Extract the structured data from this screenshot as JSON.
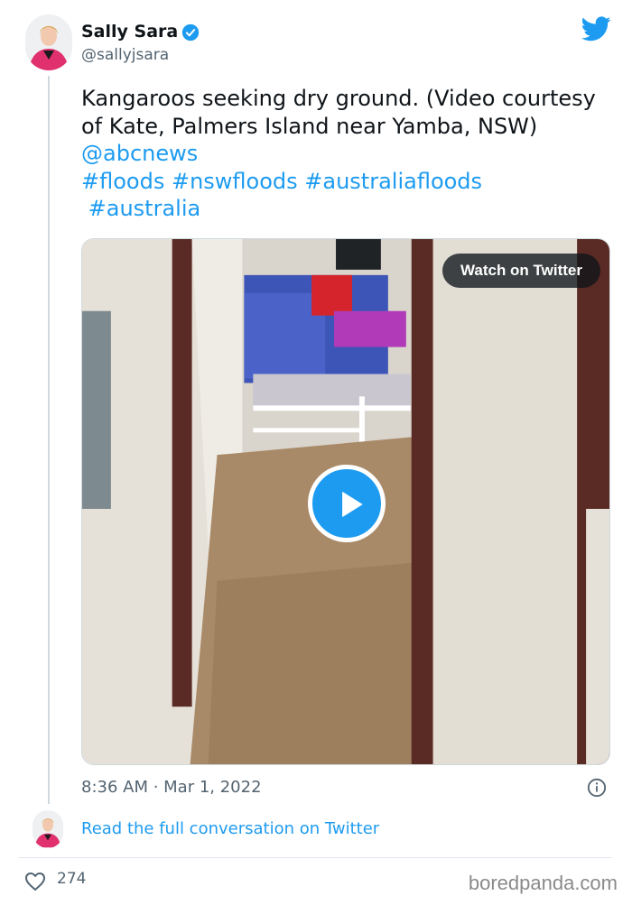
{
  "author": {
    "display_name": "Sally Sara",
    "handle": "@sallyjsara",
    "verified": true
  },
  "tweet": {
    "text_plain": "Kangaroos seeking dry ground.  (Video courtesy of Kate, Palmers Island near Yamba, NSW) ",
    "mention": "@abcnews",
    "hashtags_line1": "#floods #nswfloods #australiafloods",
    "hashtag_line2": "#australia"
  },
  "media": {
    "watch_label": "Watch on Twitter",
    "play_icon": "play-icon"
  },
  "timestamp": "8:36 AM · Mar 1, 2022",
  "read_full_conversation": "Read the full conversation on Twitter",
  "likes": "274",
  "watermark": "boredpanda.com",
  "colors": {
    "accent": "#1d9bf0",
    "text": "#0f1419",
    "muted": "#536471"
  },
  "icons": [
    "verified-badge-icon",
    "twitter-bird-icon",
    "info-icon",
    "heart-icon",
    "play-icon"
  ]
}
